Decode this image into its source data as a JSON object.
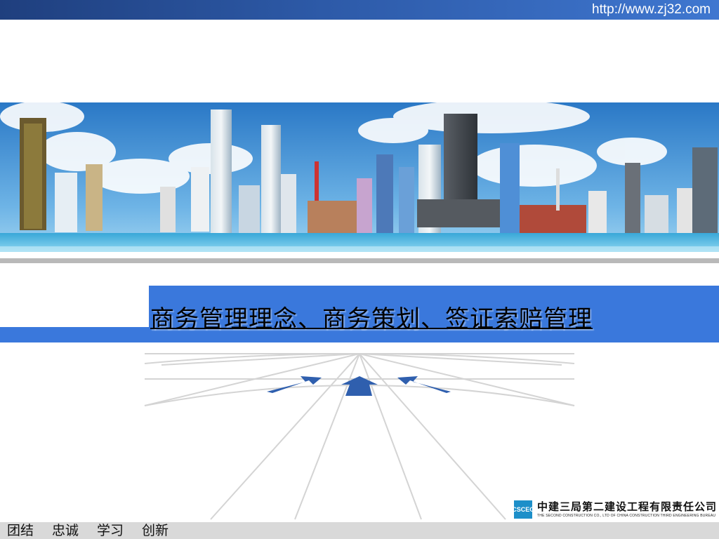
{
  "header": {
    "url": "http://www.zj32.com"
  },
  "slide": {
    "title": "商务管理理念、商务策划、签证索赔管理"
  },
  "company": {
    "logo_text": "CSCEC",
    "name_cn": "中建三局第二建设工程有限责任公司",
    "name_en": "THE SECOND CONSTRUCTION CO., LTD OF CHINA CONSTRUCTION THIRD ENGINEERING BUREAU"
  },
  "footer": {
    "motto": [
      "团结",
      "忠诚",
      "学习",
      "创新"
    ]
  },
  "colors": {
    "top_bar": "#2d5aa8",
    "title_band": "#3a78dc",
    "footer_bar": "#d9d9d9",
    "arrow": "#2f5fae"
  }
}
